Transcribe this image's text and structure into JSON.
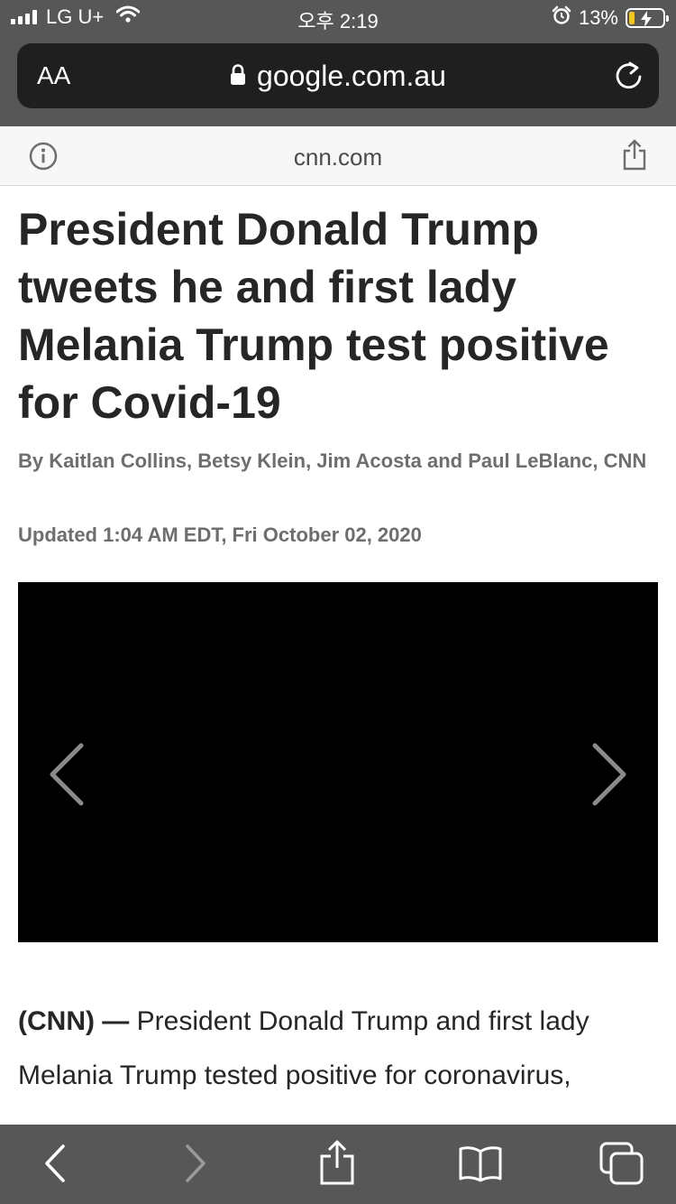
{
  "status_bar": {
    "carrier": "LG U+",
    "time": "오후 2:19",
    "battery_percent": "13%",
    "icons": [
      "signal-icon",
      "wifi-icon",
      "alarm-icon",
      "battery-charging-icon"
    ]
  },
  "browser": {
    "text_size_label": "AA",
    "address": "google.com.au",
    "site_domain": "cnn.com",
    "icons": [
      "lock-icon",
      "reload-icon",
      "info-icon",
      "share-icon"
    ]
  },
  "article": {
    "headline": "President Donald Trump tweets he and first lady Melania Trump test positive for Covid-19",
    "byline": "By Kaitlan Collins, Betsy Klein, Jim Acosta and Paul LeBlanc, CNN",
    "updated": "Updated 1:04 AM EDT, Fri October 02, 2020",
    "lead_label": "(CNN) — ",
    "body_line_1": "President Donald Trump and first lady",
    "body_line_2": "Melania Trump tested positive for coronavirus,"
  },
  "media": {
    "icons": [
      "chevron-left-icon",
      "chevron-right-icon"
    ]
  },
  "toolbar": {
    "icons": [
      "back-icon",
      "forward-icon",
      "share-icon",
      "bookmarks-icon",
      "tabs-icon"
    ]
  },
  "colors": {
    "chrome": "#575757",
    "url_field": "#1f1f1f",
    "battery_low": "#f5c518",
    "headline": "#262626",
    "meta": "#6e6e6e"
  }
}
